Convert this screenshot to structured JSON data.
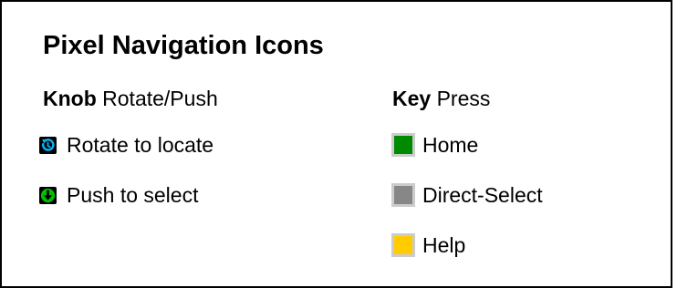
{
  "title": "Pixel Navigation Icons",
  "knob_section": {
    "heading_bold": "Knob",
    "heading_rest": "Rotate/Push",
    "items": [
      {
        "label": "Rotate to locate",
        "icon": "rotate-icon",
        "color": "#00b8ff"
      },
      {
        "label": "Push to select",
        "icon": "push-icon",
        "color": "#00c000"
      }
    ]
  },
  "key_section": {
    "heading_bold": "Key",
    "heading_rest": "Press",
    "items": [
      {
        "label": "Home",
        "icon": "home-key-icon",
        "color": "#008a00"
      },
      {
        "label": "Direct-Select",
        "icon": "direct-select-key-icon",
        "color": "#878787"
      },
      {
        "label": "Help",
        "icon": "help-key-icon",
        "color": "#ffcc00"
      }
    ]
  }
}
